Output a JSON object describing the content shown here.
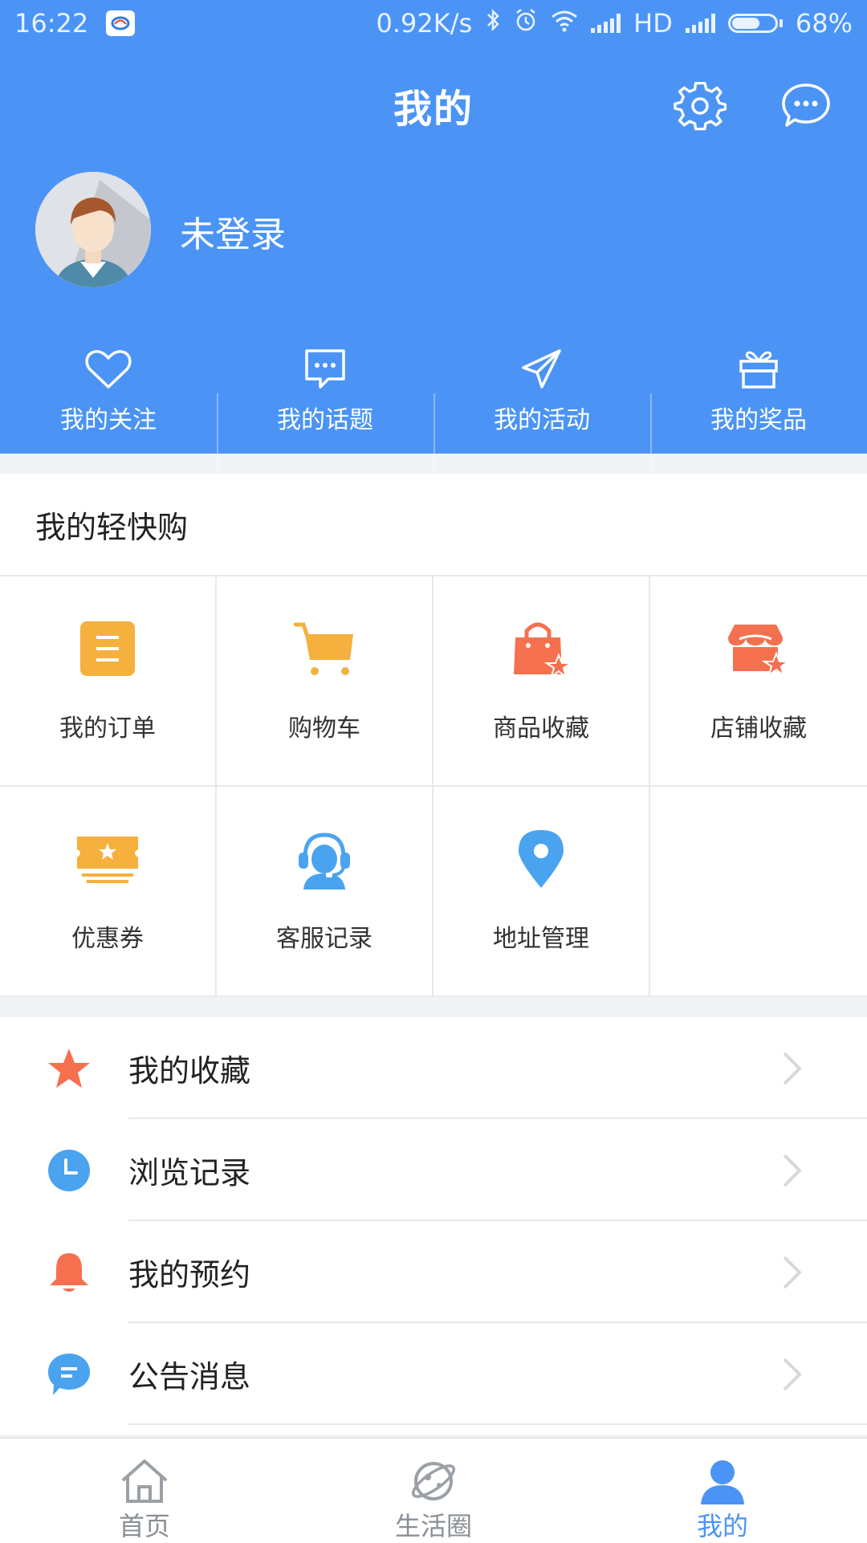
{
  "status_bar": {
    "time": "16:22",
    "net_speed": "0.92K/s",
    "network_label": "HD",
    "battery": "68%",
    "battery_level": 0.68
  },
  "header": {
    "title": "我的",
    "settings_icon": "gear-icon",
    "message_icon": "chat-bubble-icon"
  },
  "profile": {
    "username": "未登录",
    "avatar_icon": "avatar-icon"
  },
  "shortcuts": [
    {
      "label": "我的关注",
      "icon": "heart-icon"
    },
    {
      "label": "我的话题",
      "icon": "topic-bubble-icon"
    },
    {
      "label": "我的活动",
      "icon": "paper-plane-icon"
    },
    {
      "label": "我的奖品",
      "icon": "gift-icon"
    }
  ],
  "quick_shop": {
    "title": "我的轻快购",
    "items": [
      {
        "label": "我的订单",
        "icon": "order-icon"
      },
      {
        "label": "购物车",
        "icon": "cart-icon"
      },
      {
        "label": "商品收藏",
        "icon": "bag-star-icon"
      },
      {
        "label": "店铺收藏",
        "icon": "store-star-icon"
      },
      {
        "label": "优惠券",
        "icon": "coupon-icon"
      },
      {
        "label": "客服记录",
        "icon": "headset-icon"
      },
      {
        "label": "地址管理",
        "icon": "location-pin-icon"
      }
    ]
  },
  "menu_list": [
    {
      "label": "我的收藏",
      "icon": "star-icon"
    },
    {
      "label": "浏览记录",
      "icon": "clock-icon"
    },
    {
      "label": "我的预约",
      "icon": "bell-icon"
    },
    {
      "label": "公告消息",
      "icon": "message-icon"
    }
  ],
  "tab_bar": {
    "tabs": [
      {
        "label": "首页",
        "icon": "home-icon",
        "active": false
      },
      {
        "label": "生活圈",
        "icon": "planet-icon",
        "active": false
      },
      {
        "label": "我的",
        "icon": "person-icon",
        "active": true
      }
    ]
  },
  "colors": {
    "primary": "#4b94f6",
    "orange": "#f5a623",
    "coral": "#f5704f",
    "blue_icon": "#4aa3ef"
  }
}
